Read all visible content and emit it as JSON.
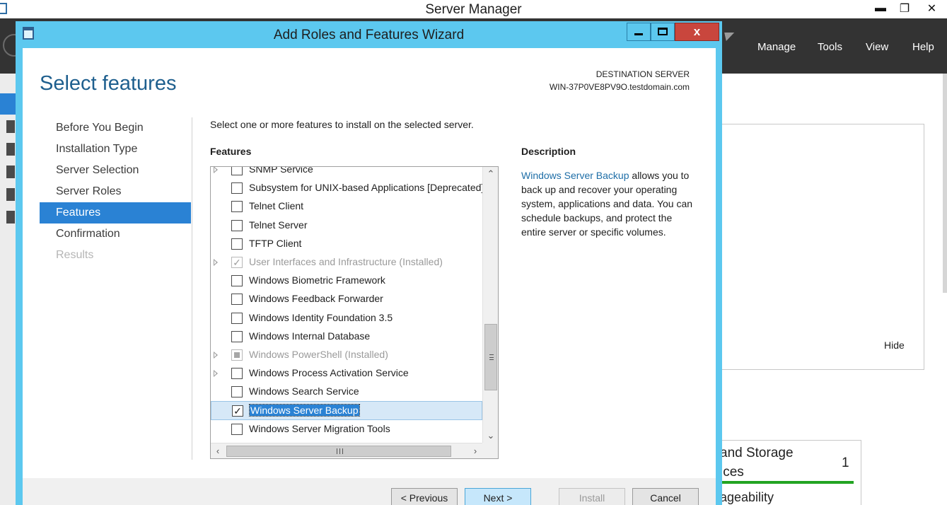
{
  "server_manager": {
    "title": "Server Manager",
    "menu": [
      "Manage",
      "Tools",
      "View",
      "Help"
    ],
    "hide_label": "Hide",
    "tile": {
      "line1": "and Storage",
      "line2": "ices",
      "count": "1",
      "line3": "ageability"
    }
  },
  "wizard": {
    "title": "Add Roles and Features Wizard",
    "close_glyph": "x",
    "page_title": "Select features",
    "destination_label": "DESTINATION SERVER",
    "destination_server": "WIN-37P0VE8PV9O.testdomain.com",
    "steps": [
      {
        "label": "Before You Begin",
        "state": "normal"
      },
      {
        "label": "Installation Type",
        "state": "normal"
      },
      {
        "label": "Server Selection",
        "state": "normal"
      },
      {
        "label": "Server Roles",
        "state": "normal"
      },
      {
        "label": "Features",
        "state": "active"
      },
      {
        "label": "Confirmation",
        "state": "normal"
      },
      {
        "label": "Results",
        "state": "disabled"
      }
    ],
    "intro": "Select one or more features to install on the selected server.",
    "features_label": "Features",
    "features": [
      {
        "label": "SNMP Service",
        "checked": false,
        "expandable": true,
        "installed": false
      },
      {
        "label": "Subsystem for UNIX-based Applications [Deprecated]",
        "checked": false,
        "expandable": false,
        "installed": false
      },
      {
        "label": "Telnet Client",
        "checked": false,
        "expandable": false,
        "installed": false
      },
      {
        "label": "Telnet Server",
        "checked": false,
        "expandable": false,
        "installed": false
      },
      {
        "label": "TFTP Client",
        "checked": false,
        "expandable": false,
        "installed": false
      },
      {
        "label": "User Interfaces and Infrastructure (Installed)",
        "checked": true,
        "expandable": true,
        "installed": true
      },
      {
        "label": "Windows Biometric Framework",
        "checked": false,
        "expandable": false,
        "installed": false
      },
      {
        "label": "Windows Feedback Forwarder",
        "checked": false,
        "expandable": false,
        "installed": false
      },
      {
        "label": "Windows Identity Foundation 3.5",
        "checked": false,
        "expandable": false,
        "installed": false
      },
      {
        "label": "Windows Internal Database",
        "checked": false,
        "expandable": false,
        "installed": false
      },
      {
        "label": "Windows PowerShell (Installed)",
        "checked": "partial",
        "expandable": true,
        "installed": true
      },
      {
        "label": "Windows Process Activation Service",
        "checked": false,
        "expandable": true,
        "installed": false
      },
      {
        "label": "Windows Search Service",
        "checked": false,
        "expandable": false,
        "installed": false
      },
      {
        "label": "Windows Server Backup",
        "checked": true,
        "expandable": false,
        "installed": false,
        "selected": true
      },
      {
        "label": "Windows Server Migration Tools",
        "checked": false,
        "expandable": false,
        "installed": false
      }
    ],
    "description_label": "Description",
    "description_link": "Windows Server Backup",
    "description_text": " allows you to back up and recover your operating system, applications and data. You can schedule backups, and protect the entire server or specific volumes.",
    "buttons": {
      "previous": "< Previous",
      "next": "Next >",
      "install": "Install",
      "cancel": "Cancel"
    }
  },
  "colors": {
    "wizard_frame": "#5cc8ef",
    "accent": "#2a82d4",
    "title_blue": "#1e5f8e",
    "close_red": "#c9463d",
    "dashboard_dark": "#333333"
  }
}
